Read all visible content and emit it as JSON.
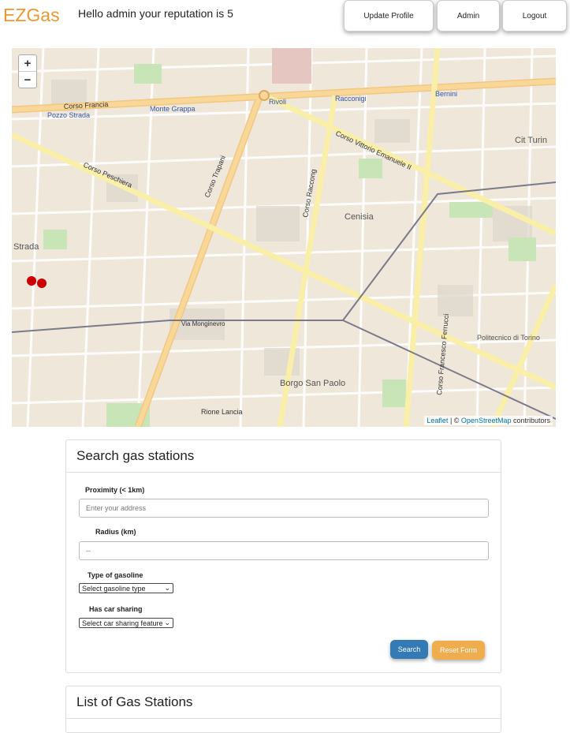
{
  "header": {
    "brand": "EZGas",
    "greeting": "Hello admin your reputation is 5",
    "buttons": {
      "update_profile": "Update Profile",
      "admin": "Admin",
      "logout": "Logout"
    }
  },
  "map": {
    "zoom_in": "+",
    "zoom_out": "−",
    "attribution": {
      "leaflet": "Leaflet",
      "separator": " | © ",
      "osm": "OpenStreetMap",
      "suffix": " contributors"
    },
    "labels": [
      "Corso Francia",
      "Corso Peschiera",
      "Corso Trapani",
      "Corso Vittorio Emanuele II",
      "Corso Raccong",
      "Corso Francesco Ferrucci",
      "Cenisia",
      "Borgo San Paolo",
      "Monte Grappa",
      "Pozzo Strada",
      "Rivoli",
      "Racconigi",
      "Bernini",
      "Cit Turin",
      "Politecnico di Torino",
      "Rione Lancia",
      "Via Monginevro",
      "Strada"
    ]
  },
  "search": {
    "title": "Search gas stations",
    "proximity_label": "Proximity (< 1km)",
    "proximity_placeholder": "Enter your address",
    "radius_label": "Radius (km)",
    "radius_placeholder": "--",
    "gasoline_label": "Type of gasoline",
    "gasoline_selected": "Select gasoline type",
    "carsharing_label": "Has car sharing",
    "carsharing_selected": "Select car sharing feature",
    "search_button": "Search",
    "reset_button": "Reset Form"
  },
  "list": {
    "title": "List of Gas Stations"
  }
}
